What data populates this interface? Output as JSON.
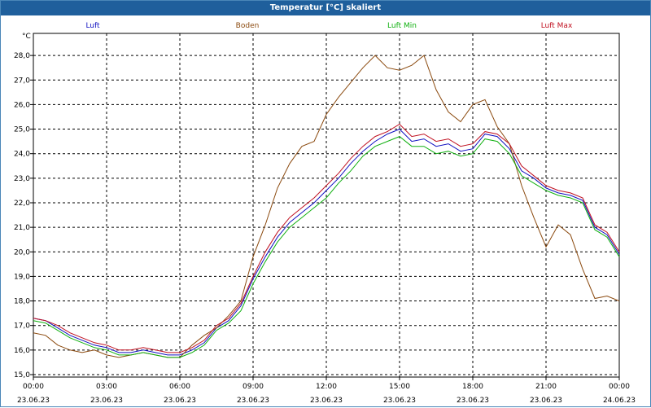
{
  "window": {
    "title": "Temperatur [°C] skaliert"
  },
  "chart_data": {
    "type": "line",
    "title": "Temperatur [°C] skaliert",
    "ylabel": "°C",
    "xlabel": "",
    "ylim": [
      14.9,
      28.9
    ],
    "xlim": [
      0,
      24
    ],
    "grid": true,
    "legend_position": "top",
    "y_ticks": [
      "15,0",
      "16,0",
      "17,0",
      "18,0",
      "19,0",
      "20,0",
      "21,0",
      "22,0",
      "23,0",
      "24,0",
      "25,0",
      "26,0",
      "27,0",
      "28,0"
    ],
    "x_ticks": [
      {
        "time": "00:00",
        "date": "23.06.23"
      },
      {
        "time": "03:00",
        "date": "23.06.23"
      },
      {
        "time": "06:00",
        "date": "23.06.23"
      },
      {
        "time": "09:00",
        "date": "23.06.23"
      },
      {
        "time": "12:00",
        "date": "23.06.23"
      },
      {
        "time": "15:00",
        "date": "23.06.23"
      },
      {
        "time": "18:00",
        "date": "23.06.23"
      },
      {
        "time": "21:00",
        "date": "23.06.23"
      },
      {
        "time": "00:00",
        "date": "24.06.23"
      }
    ],
    "x_hours": [
      0,
      0.5,
      1,
      1.5,
      2,
      2.5,
      3,
      3.5,
      4,
      4.5,
      5,
      5.5,
      6,
      6.5,
      7,
      7.5,
      8,
      8.5,
      9,
      9.5,
      10,
      10.5,
      11,
      11.5,
      12,
      12.5,
      13,
      13.5,
      14,
      14.5,
      15,
      15.5,
      16,
      16.5,
      17,
      17.5,
      18,
      18.5,
      19,
      19.5,
      20,
      20.5,
      21,
      21.5,
      22,
      22.5,
      23,
      23.5,
      24
    ],
    "series": [
      {
        "name": "Luft",
        "color": "#1010c0",
        "values": [
          17.3,
          17.2,
          16.9,
          16.6,
          16.4,
          16.2,
          16.1,
          15.9,
          15.9,
          16.0,
          15.9,
          15.8,
          15.8,
          16.0,
          16.3,
          16.9,
          17.2,
          17.8,
          18.9,
          19.8,
          20.6,
          21.2,
          21.6,
          22.0,
          22.5,
          23.0,
          23.6,
          24.1,
          24.5,
          24.8,
          25.0,
          24.5,
          24.6,
          24.3,
          24.4,
          24.1,
          24.2,
          24.8,
          24.7,
          24.2,
          23.3,
          23.0,
          22.6,
          22.4,
          22.3,
          22.1,
          21.0,
          20.7,
          19.9
        ]
      },
      {
        "name": "Boden",
        "color": "#8b4a0f",
        "values": [
          16.7,
          16.6,
          16.2,
          16.0,
          15.9,
          16.0,
          15.8,
          15.7,
          15.8,
          15.9,
          15.8,
          15.7,
          15.7,
          16.2,
          16.6,
          16.9,
          17.4,
          18.0,
          19.8,
          21.1,
          22.6,
          23.6,
          24.3,
          24.5,
          25.6,
          26.3,
          26.9,
          27.5,
          28.0,
          27.5,
          27.4,
          27.6,
          28.0,
          26.6,
          25.7,
          25.3,
          26.0,
          26.2,
          25.1,
          24.4,
          22.7,
          21.4,
          20.2,
          21.1,
          20.7,
          19.3,
          18.1,
          18.2,
          18.0
        ]
      },
      {
        "name": "Luft Min",
        "color": "#10b010",
        "values": [
          17.2,
          17.1,
          16.8,
          16.5,
          16.3,
          16.1,
          16.0,
          15.8,
          15.8,
          15.9,
          15.8,
          15.7,
          15.7,
          15.9,
          16.2,
          16.8,
          17.1,
          17.6,
          18.7,
          19.6,
          20.4,
          21.0,
          21.4,
          21.8,
          22.2,
          22.8,
          23.3,
          23.9,
          24.3,
          24.5,
          24.7,
          24.3,
          24.3,
          24.0,
          24.1,
          23.9,
          24.0,
          24.6,
          24.5,
          24.0,
          23.1,
          22.8,
          22.5,
          22.3,
          22.2,
          22.0,
          20.9,
          20.6,
          19.8
        ]
      },
      {
        "name": "Luft Max",
        "color": "#c01020",
        "values": [
          17.3,
          17.2,
          17.0,
          16.7,
          16.5,
          16.3,
          16.2,
          16.0,
          16.0,
          16.1,
          16.0,
          15.9,
          15.9,
          16.1,
          16.4,
          17.0,
          17.3,
          17.9,
          19.0,
          20.0,
          20.8,
          21.4,
          21.8,
          22.2,
          22.7,
          23.2,
          23.8,
          24.3,
          24.7,
          24.9,
          25.2,
          24.7,
          24.8,
          24.5,
          24.6,
          24.3,
          24.4,
          24.9,
          24.8,
          24.4,
          23.5,
          23.1,
          22.7,
          22.5,
          22.4,
          22.2,
          21.1,
          20.8,
          20.0
        ]
      }
    ]
  }
}
